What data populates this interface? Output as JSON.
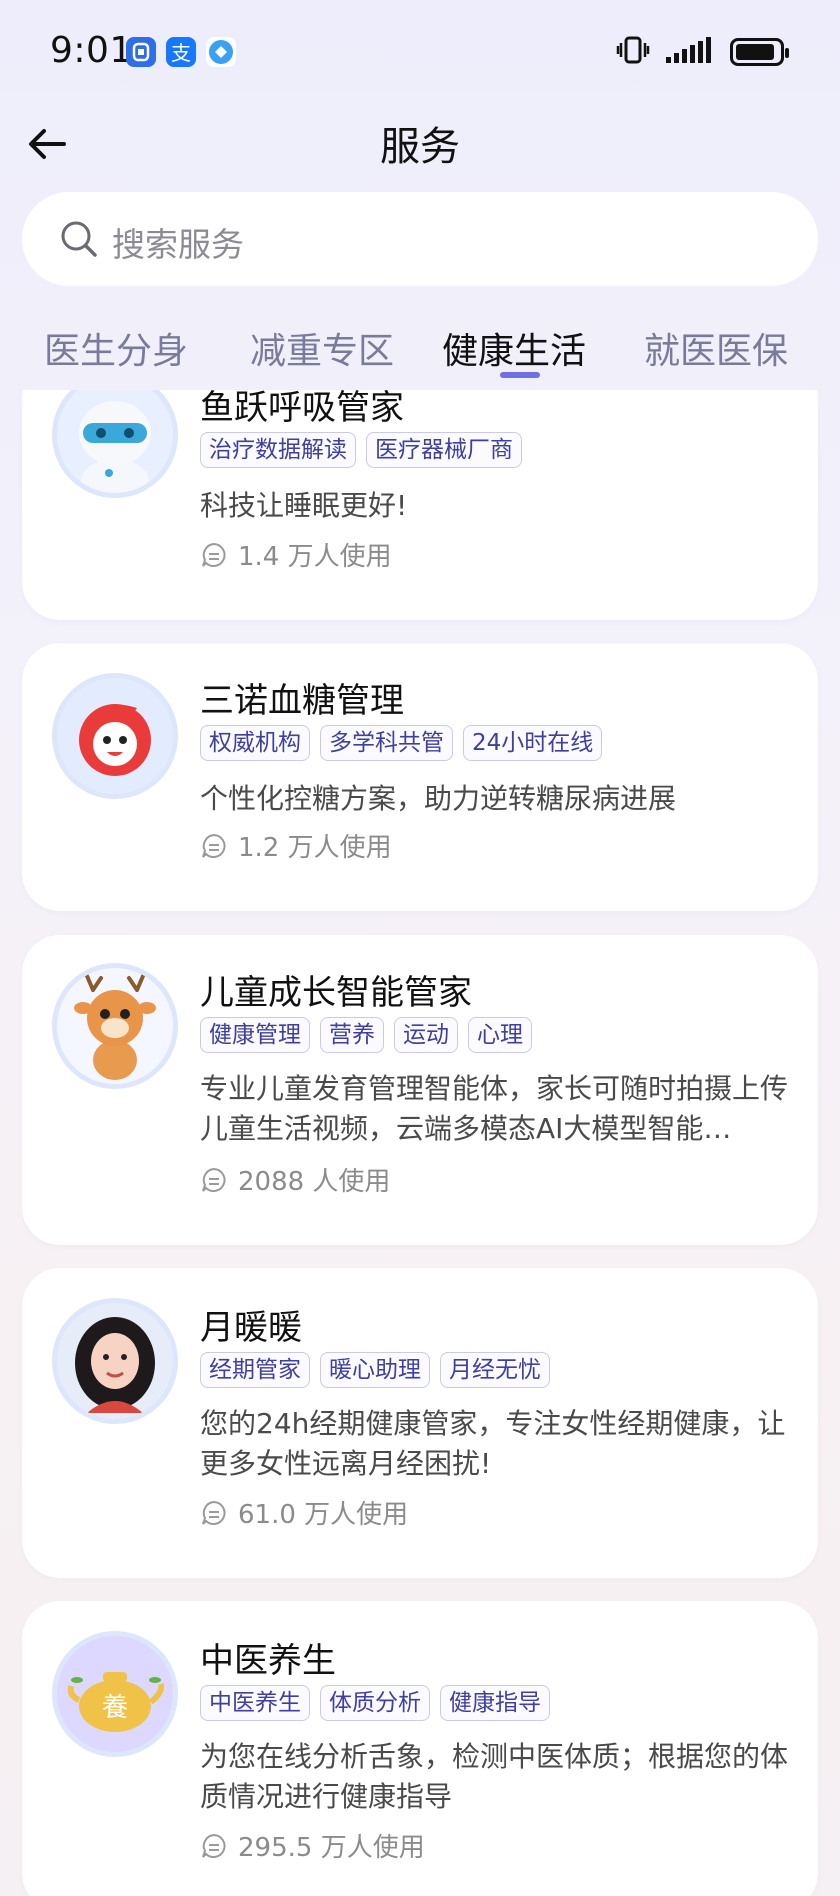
{
  "status_bar": {
    "time": "9:01",
    "left_icons": [
      "notification-app-icon",
      "alipay-icon",
      "app-icon"
    ],
    "right_icons": [
      "vibrate-icon",
      "signal-icon",
      "battery-icon"
    ],
    "battery_level": 0.9
  },
  "header": {
    "title": "服务"
  },
  "search": {
    "placeholder": "搜索服务"
  },
  "tabs": [
    {
      "label": "医生分身",
      "active": false
    },
    {
      "label": "减重专区",
      "active": false
    },
    {
      "label": "健康生活",
      "active": true
    },
    {
      "label": "就医医保",
      "active": false
    }
  ],
  "cards": [
    {
      "title": "鱼跃呼吸管家",
      "tags": [
        "治疗数据解读",
        "医疗器械厂商"
      ],
      "description": "科技让睡眠更好!",
      "usage": "1.4 万人使用",
      "avatar_icon": "robot-avatar-icon"
    },
    {
      "title": "三诺血糖管理",
      "tags": [
        "权威机构",
        "多学科共管",
        "24小时在线"
      ],
      "description": "个性化控糖方案，助力逆转糖尿病进展",
      "usage": "1.2 万人使用",
      "avatar_icon": "mascot-avatar-icon"
    },
    {
      "title": "儿童成长智能管家",
      "tags": [
        "健康管理",
        "营养",
        "运动",
        "心理"
      ],
      "description": "专业儿童发育管理智能体，家长可随时拍摄上传儿童生活视频，云端多模态AI大模型智能…",
      "usage": "2088 人使用",
      "avatar_icon": "deer-avatar-icon"
    },
    {
      "title": "月暖暖",
      "tags": [
        "经期管家",
        "暖心助理",
        "月经无忧"
      ],
      "description": "您的24h经期健康管家，专注女性经期健康，让更多女性远离月经困扰!",
      "usage": "61.0 万人使用",
      "avatar_icon": "woman-avatar-icon"
    },
    {
      "title": "中医养生",
      "tags": [
        "中医养生",
        "体质分析",
        "健康指导"
      ],
      "description": "为您在线分析舌象，检测中医体质；根据您的体质情况进行健康指导",
      "usage": "295.5 万人使用",
      "avatar_icon": "teapot-avatar-icon",
      "avatar_text": "養"
    }
  ]
}
